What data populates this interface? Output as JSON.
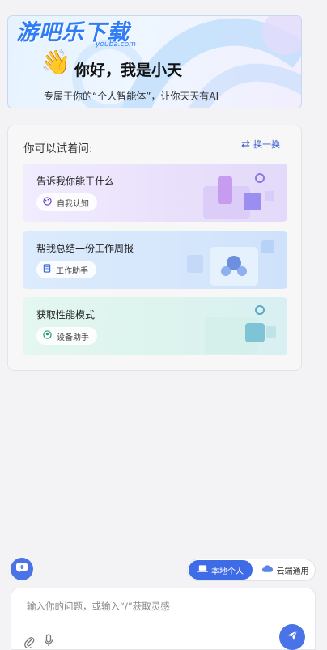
{
  "watermark": {
    "text": "游吧乐下载",
    "sub": "youba.com"
  },
  "hero": {
    "greeting": "你好，我是小天",
    "subtitle": "专属于你的“个人智能体”，让你天天有AI",
    "wave_emoji": "👋"
  },
  "suggestions": {
    "title": "你可以试着问:",
    "refresh_label": "换一换",
    "items": [
      {
        "title": "告诉我你能干什么",
        "chip": "自我认知",
        "chip_icon": "palette-icon"
      },
      {
        "title": "帮我总结一份工作周报",
        "chip": "工作助手",
        "chip_icon": "document-icon"
      },
      {
        "title": "获取性能模式",
        "chip": "设备助手",
        "chip_icon": "person-circle-icon"
      }
    ]
  },
  "mode": {
    "local_label": "本地个人",
    "cloud_label": "云端通用",
    "selected": "local"
  },
  "input": {
    "placeholder": "输入你的问题，或输入“/”获取灵感"
  },
  "colors": {
    "accent": "#4a73e8",
    "accent_dark": "#3e6ce6"
  }
}
